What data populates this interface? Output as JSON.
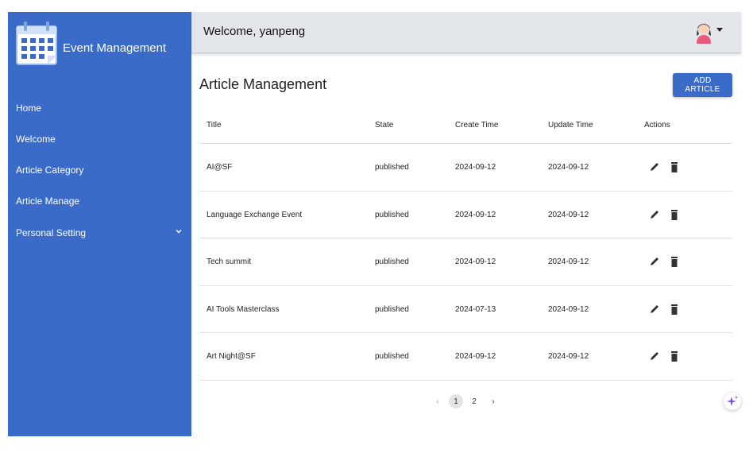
{
  "sidebar": {
    "brand": "Event Management",
    "items": [
      {
        "label": "Home"
      },
      {
        "label": "Welcome"
      },
      {
        "label": "Article Category"
      },
      {
        "label": "Article Manage"
      },
      {
        "label": "Personal Setting",
        "icon": "chevron-down-icon"
      }
    ]
  },
  "header": {
    "welcome": "Welcome, yanpeng",
    "avatar_icon": "user-avatar",
    "menu_icon": "caret-down-icon"
  },
  "main": {
    "title": "Article Management",
    "add_button": "ADD ARTICLE",
    "columns": [
      "Title",
      "State",
      "Create Time",
      "Update Time",
      "Actions"
    ],
    "rows": [
      {
        "title": "AI@SF",
        "state": "published",
        "create": "2024-09-12",
        "update": "2024-09-12"
      },
      {
        "title": "Language Exchange Event",
        "state": "published",
        "create": "2024-09-12",
        "update": "2024-09-12"
      },
      {
        "title": "Tech summit",
        "state": "published",
        "create": "2024-09-12",
        "update": "2024-09-12"
      },
      {
        "title": "AI Tools Masterclass",
        "state": "published",
        "create": "2024-07-13",
        "update": "2024-09-12"
      },
      {
        "title": "Art Night@SF",
        "state": "published",
        "create": "2024-09-12",
        "update": "2024-09-12"
      }
    ],
    "actions_icons": [
      "edit-icon",
      "delete-icon"
    ]
  },
  "pagination": {
    "prev": "‹",
    "pages": [
      "1",
      "2"
    ],
    "active": "1",
    "next": "›"
  },
  "colors": {
    "primary": "#3a6bc9",
    "header_bg": "#e3e6ea"
  }
}
